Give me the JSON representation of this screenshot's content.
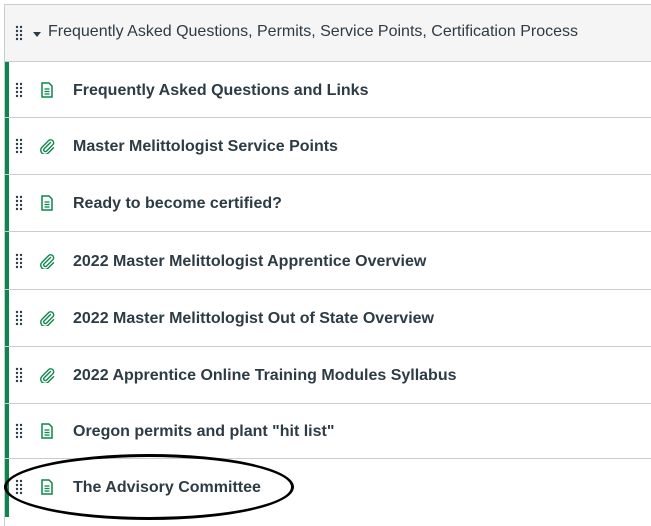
{
  "module": {
    "title": "Frequently Asked Questions, Permits, Service Points, Certification Process"
  },
  "items": [
    {
      "type": "page",
      "label": "Frequently Asked Questions and Links"
    },
    {
      "type": "attachment",
      "label": "Master Melittologist Service Points"
    },
    {
      "type": "page",
      "label": "Ready to become certified?"
    },
    {
      "type": "attachment",
      "label": "2022 Master Melittologist Apprentice Overview"
    },
    {
      "type": "attachment",
      "label": "2022 Master Melittologist Out of State Overview"
    },
    {
      "type": "attachment",
      "label": "2022 Apprentice Online Training Modules Syllabus"
    },
    {
      "type": "page",
      "label": "Oregon permits and plant \"hit list\""
    },
    {
      "type": "page",
      "label": "The Advisory Committee"
    }
  ],
  "colors": {
    "accent_bar": "#0b874b",
    "icon_green": "#0b874b",
    "text": "#2d3b45",
    "border": "#c7cdd1",
    "header_bg": "#f5f5f5",
    "annotation": "#000000"
  }
}
